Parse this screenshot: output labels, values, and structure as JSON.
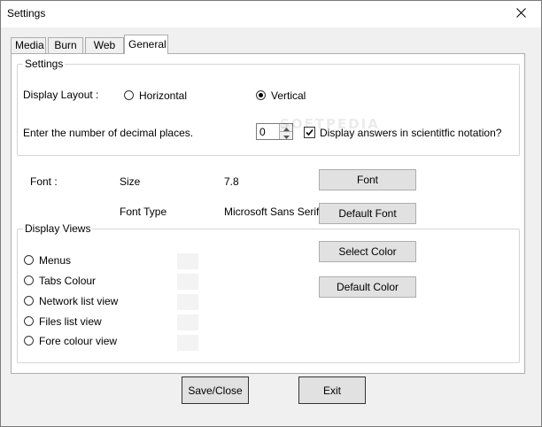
{
  "window": {
    "title": "Settings",
    "close_glyph": "✕"
  },
  "tabs": [
    {
      "label": "Media",
      "active": false
    },
    {
      "label": "Burn",
      "active": false
    },
    {
      "label": "Web",
      "active": false
    },
    {
      "label": "General",
      "active": true
    }
  ],
  "settings_group": {
    "legend": "Settings",
    "display_layout_label": "Display Layout :",
    "layout_options": [
      {
        "label": "Horizontal",
        "checked": false
      },
      {
        "label": "Vertical",
        "checked": true
      }
    ],
    "decimal_label": "Enter the number of decimal places.",
    "decimal_value": "0",
    "scientific_label": "Display answers in scientitfic notation?",
    "scientific_checked": true
  },
  "font_section": {
    "font_label": "Font :",
    "size_label": "Size",
    "size_value": "7.8",
    "font_button": "Font",
    "font_type_label": "Font Type",
    "font_type_value": "Microsoft Sans Serif",
    "default_font_button": "Default Font"
  },
  "display_views": {
    "legend": "Display Views",
    "items": [
      {
        "label": "Menus"
      },
      {
        "label": "Tabs Colour"
      },
      {
        "label": "Network list view"
      },
      {
        "label": "Files list view"
      },
      {
        "label": "Fore colour view"
      }
    ],
    "select_color_button": "Select Color",
    "default_color_button": "Default Color"
  },
  "watermark": "SOFTPEDIA",
  "footer": {
    "save_close_button": "Save/Close",
    "exit_button": "Exit"
  },
  "colors": {
    "window_bg": "#f0f0f0",
    "panel_bg": "#ffffff",
    "button_bg": "#e1e1e1"
  }
}
